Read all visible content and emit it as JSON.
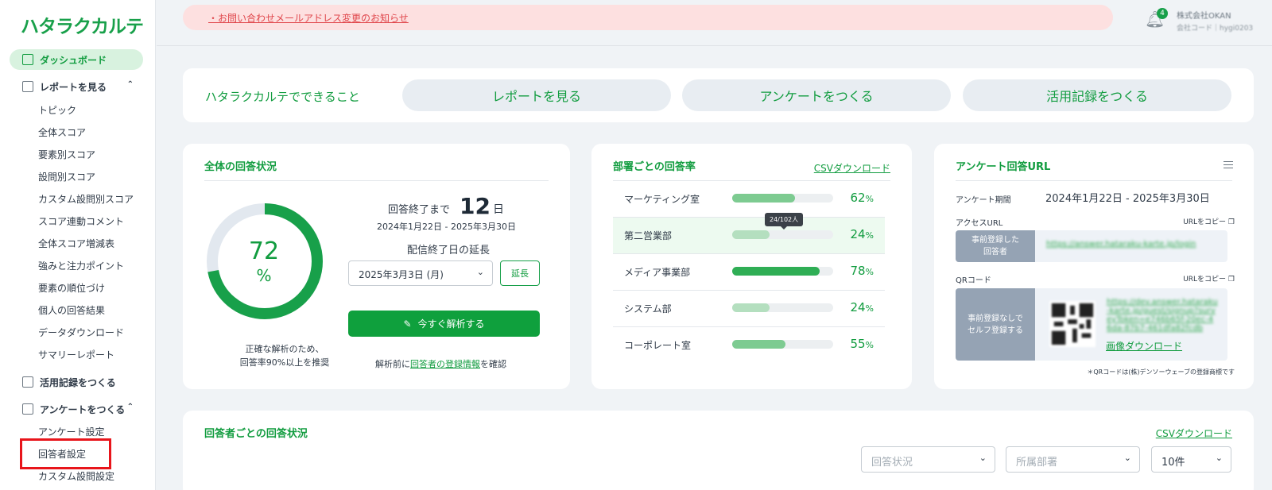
{
  "brand": {
    "logo": "ハタラクカルテ",
    "accent": "#18a04a"
  },
  "sidebar": {
    "dashboard": "ダッシュボード",
    "report": "レポートを見る",
    "report_items": [
      "トピック",
      "全体スコア",
      "要素別スコア",
      "設問別スコア",
      "カスタム設問別スコア",
      "スコア連動コメント",
      "全体スコア増減表",
      "強みと注力ポイント",
      "要素の順位づけ",
      "個人の回答結果",
      "データダウンロード",
      "サマリーレポート"
    ],
    "activity": "活用記録をつくる",
    "survey": "アンケートをつくる",
    "survey_items": [
      "アンケート設定",
      "回答者設定",
      "カスタム設問設定"
    ]
  },
  "header": {
    "notice": "・お問い合わせメールアドレス変更のお知らせ",
    "notification_count": "4",
    "company_name": "株式会社OKAN",
    "company_code": "会社コード｜hygi0203"
  },
  "hero": {
    "title": "ハタラクカルテでできること",
    "buttons": [
      "レポートを見る",
      "アンケートをつくる",
      "活用記録をつくる"
    ]
  },
  "overall": {
    "title": "全体の回答状況",
    "rate": "72",
    "rate_fraction": 0.72,
    "unit": "%",
    "note_line1": "正確な解析のため、",
    "note_line2": "回答率90%以上を推奨",
    "until_label": "回答終了まで",
    "days": "12",
    "days_unit": "日",
    "period": "2024年1月22日 - 2025年3月30日",
    "extend_label": "配信終了日の延長",
    "date_value": "2025年3月3日 (月)",
    "extend_button": "延長",
    "analyze_button": "今すぐ解析する",
    "analyze_note_prefix": "解析前に",
    "analyze_note_link": "回答者の登録情報",
    "analyze_note_suffix": "を確認"
  },
  "departments": {
    "title": "部署ごとの回答率",
    "csv": "CSVダウンロード",
    "tooltip": "24/102人",
    "rows": [
      {
        "name": "マーケティング室",
        "pct": "62",
        "fill": 0.62,
        "color": "#7dcb91"
      },
      {
        "name": "第二営業部",
        "pct": "24",
        "fill": 0.37,
        "color": "#b4dfbf"
      },
      {
        "name": "メディア事業部",
        "pct": "78",
        "fill": 0.87,
        "color": "#2fae55"
      },
      {
        "name": "システム部",
        "pct": "24",
        "fill": 0.37,
        "color": "#b4dfbf"
      },
      {
        "name": "コーポレート室",
        "pct": "55",
        "fill": 0.53,
        "color": "#7dcb91"
      }
    ]
  },
  "survey_url": {
    "title": "アンケート回答URL",
    "period_label": "アンケート期間",
    "period_value": "2024年1月22日 - 2025年3月30日",
    "access_label": "アクセスURL",
    "copy_url": "URLをコピー",
    "registered_tag_1": "事前登録した",
    "registered_tag_2": "回答者",
    "registered_url": "https://answer.hataraku-karte.jp/login",
    "qr_label": "QRコード",
    "self_tag_1": "事前登録なしで",
    "self_tag_2": "セルフ登録する",
    "self_url": "https://dev.answer.hataraku-karte.jp/guest/signup?surveyToken=e746b65f-20ec-46da-87b7-461dfa82fcdb",
    "image_download": "画像ダウンロード",
    "qr_note": "＊QRコードは(株)デンソーウェーブの登録商標です"
  },
  "respondents": {
    "title": "回答者ごとの回答状況",
    "csv": "CSVダウンロード",
    "filter_status": "回答状況",
    "filter_dept": "所属部署",
    "per_page": "10件"
  }
}
